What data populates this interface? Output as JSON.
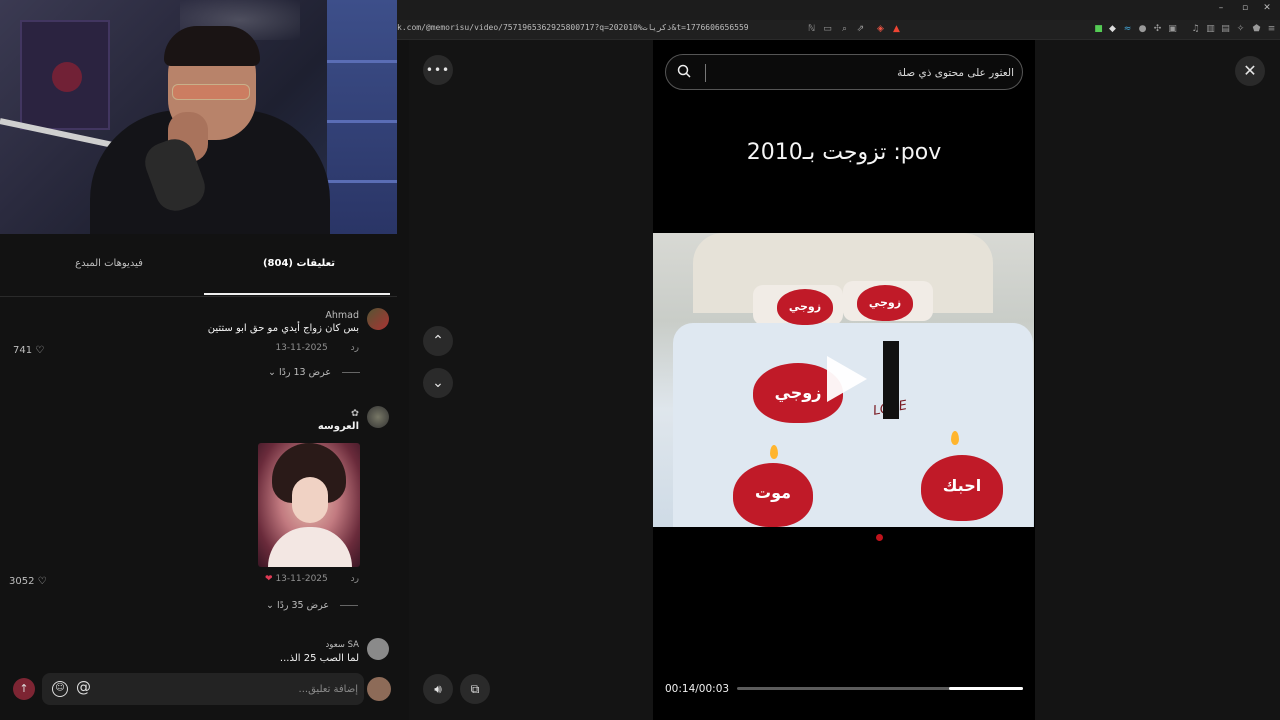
{
  "browser": {
    "url": "k.com/@memorisu/video/7571965362925800717?q=202010%ذكريات&t=1776606656559",
    "window_controls": [
      "–",
      "▫",
      "✕"
    ]
  },
  "comments_panel": {
    "tabs": {
      "comments": "(804) تعليقات",
      "creator_videos": "فيديوهات المبدع"
    },
    "comments": [
      {
        "name": "Ahmad",
        "text": "بس كان زواج أيدي مو حق ابو ستتين",
        "date": "2025-11-13",
        "reply": "رد",
        "likes": "741",
        "view_replies": "عرض 13 ردًا"
      },
      {
        "name": "✿",
        "text": "العروسه",
        "date": "2025-11-13",
        "reply": "رد",
        "likes": "3052",
        "view_replies": "عرض 35 ردًا",
        "creator_liked": "❤"
      },
      {
        "name": "سعود SA",
        "text": "لما الصب 25 الذ..."
      }
    ],
    "composer": {
      "placeholder": "إضافة تعليق..."
    }
  },
  "player": {
    "search_placeholder": "العثور على محتوى ذي صلة",
    "caption": "تزوجت بـ2010 :pov",
    "video_text": {
      "heart_left": "موت",
      "heart_right": "احبك",
      "pillow_left": "زوجي",
      "pillow_right": "زوجي",
      "love_word": "LOVE",
      "heart_center": "زوجي"
    },
    "time": "00:14/00:03",
    "progress_remaining_fraction": 0.26,
    "icons": {
      "more": "more-icon",
      "close": "close-icon",
      "up": "chevron-up-icon",
      "down": "chevron-down-icon",
      "volume": "volume-icon",
      "pip": "picture-in-picture-icon"
    }
  },
  "colors": {
    "accent_red": "#c01a28",
    "send_button": "#7d2533",
    "background": "#121212"
  }
}
